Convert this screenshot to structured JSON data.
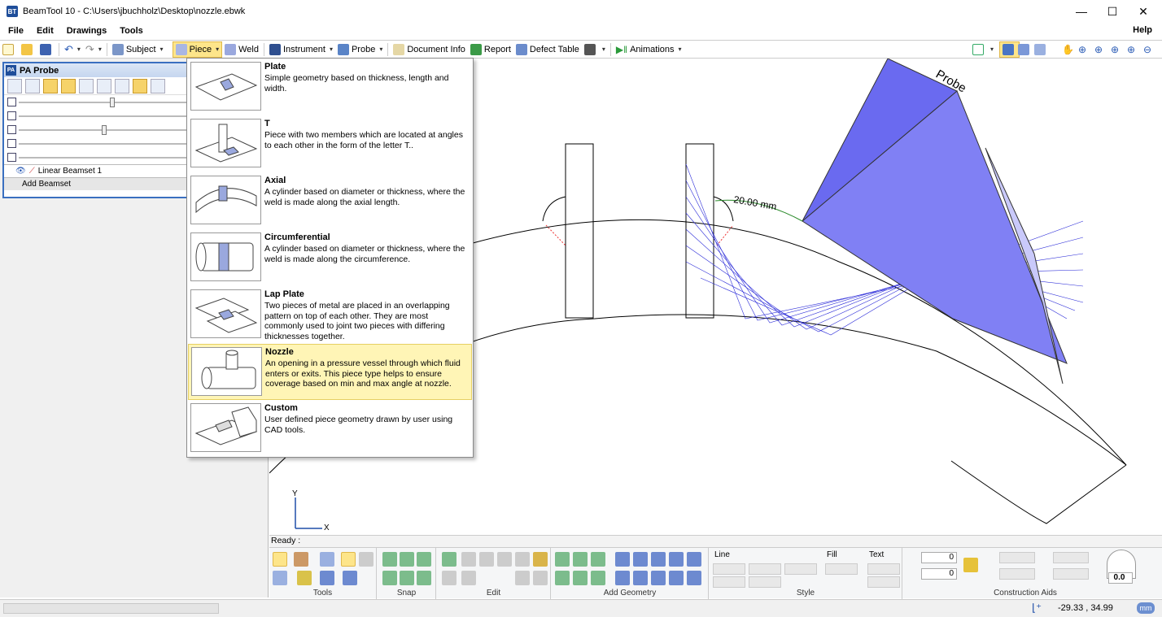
{
  "window": {
    "title": "BeamTool 10 - C:\\Users\\jbuchholz\\Desktop\\nozzle.ebwk",
    "logo": "BT",
    "minimize": "—",
    "maximize": "☐",
    "close": "✕"
  },
  "menu": [
    "File",
    "Edit",
    "Drawings",
    "Tools"
  ],
  "menu_help": "Help",
  "toolbar": {
    "subject": "Subject",
    "piece": "Piece",
    "weld": "Weld",
    "instrument": "Instrument",
    "probe": "Probe",
    "document_info": "Document Info",
    "report": "Report",
    "defect_table": "Defect Table",
    "animations": "Animations"
  },
  "pa_panel": {
    "badge": "PA",
    "title": "PA Probe",
    "beamset": "Linear Beamset 1",
    "add_beamset": "Add Beamset"
  },
  "piece_menu": [
    {
      "title": "Plate",
      "desc": "Simple geometry based on thickness, length and width.",
      "icon": "plate-icon"
    },
    {
      "title": "T",
      "desc": "Piece with two members which are located at angles to each other in the form of the letter T..",
      "icon": "t-piece-icon"
    },
    {
      "title": "Axial",
      "desc": "A cylinder based on diameter or thickness, where the weld is made along the axial length.",
      "icon": "axial-icon"
    },
    {
      "title": "Circumferential",
      "desc": "A cylinder based on diameter or thickness, where the weld is made along the circumference.",
      "icon": "circumferential-icon"
    },
    {
      "title": "Lap Plate",
      "desc": "Two pieces of metal are placed in an overlapping pattern on top of each other. They are most commonly used to joint two pieces with differing thicknesses together.",
      "icon": "lap-plate-icon"
    },
    {
      "title": "Nozzle",
      "desc": "An opening in a pressure vessel through which fluid enters or exits.  This piece type helps to ensure coverage based on min and max angle at nozzle.",
      "icon": "nozzle-icon"
    },
    {
      "title": "Custom",
      "desc": "User defined piece geometry drawn by user using CAD tools.",
      "icon": "custom-icon"
    }
  ],
  "canvas": {
    "dimension_label": "20.00 mm",
    "probe_label": "Probe",
    "axis_y": "Y",
    "axis_x": "X"
  },
  "status": {
    "ready": "Ready :",
    "coords": "-29.33 , 34.99",
    "unit": "mm"
  },
  "ribbon": {
    "groups": [
      "Tools",
      "Snap",
      "Edit",
      "Add Geometry",
      "Style",
      "Construction Aids"
    ],
    "line_label": "Line",
    "fill_label": "Fill",
    "text_label": "Text",
    "field1": "0",
    "field2": "0",
    "angle": "0.0"
  },
  "colors": {
    "accent_blue": "#3a6fc0",
    "beam_blue": "#2b2bd8",
    "probe_fill": "#6a6af0",
    "highlight_yellow": "#fff5b6"
  }
}
